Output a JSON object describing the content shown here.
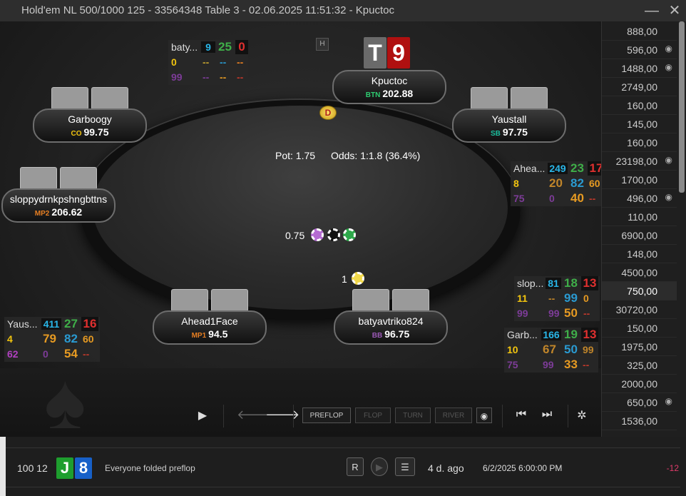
{
  "window": {
    "title": "Hold'em NL 500/1000 125 - 33564348 Table 3 - 02.06.2025 11:51:32 - Kpuctoc",
    "minimize_glyph": "—",
    "close_glyph": "✕"
  },
  "table": {
    "pot_label": "Pot:",
    "pot_value": "1.75",
    "odds_label": "Odds:",
    "odds_value": "1:1.8 (36.4%)",
    "dealer_glyph": "D",
    "bets": [
      {
        "amount": "0.75"
      },
      {
        "amount": "1"
      }
    ],
    "hero_cards": [
      {
        "rank": "T",
        "color": "#6a6a6a"
      },
      {
        "rank": "9",
        "color": "#b01010"
      }
    ],
    "replayer_icon": "hand-history-icon"
  },
  "players": [
    {
      "name": "Kpuctoc",
      "pos": "BTN",
      "stack": "202.88",
      "pos_color": "#2ecc71"
    },
    {
      "name": "Garboogy",
      "pos": "CO",
      "stack": "99.75",
      "pos_color": "#f1c40f"
    },
    {
      "name": "Yaustall",
      "pos": "SB",
      "stack": "97.75",
      "pos_color": "#1abc9c"
    },
    {
      "name": "sloppydrnkpshngbttns",
      "pos": "MP2",
      "stack": "206.62",
      "pos_color": "#e67e22"
    },
    {
      "name": "Ahead1Face",
      "pos": "MP1",
      "stack": "94.5",
      "pos_color": "#e67e22"
    },
    {
      "name": "batyavtriko824",
      "pos": "BB",
      "stack": "96.75",
      "pos_color": "#9b59b6"
    }
  ],
  "huds": [
    {
      "name": "baty...",
      "r1": [
        "9",
        "25",
        "0"
      ],
      "r2": [
        "0",
        "--",
        "--",
        "--"
      ],
      "r3": [
        "99",
        "--",
        "--",
        "--"
      ]
    },
    {
      "name": "Ahea...",
      "r1": [
        "249",
        "23",
        "17"
      ],
      "r2": [
        "8",
        "20",
        "82",
        "60"
      ],
      "r3": [
        "75",
        "0",
        "40",
        "--"
      ]
    },
    {
      "name": "slop...",
      "r1": [
        "81",
        "18",
        "13"
      ],
      "r2": [
        "11",
        "--",
        "99",
        "0"
      ],
      "r3": [
        "99",
        "99",
        "50",
        "--"
      ]
    },
    {
      "name": "Garb...",
      "r1": [
        "166",
        "19",
        "13"
      ],
      "r2": [
        "10",
        "67",
        "50",
        "99"
      ],
      "r3": [
        "75",
        "99",
        "33",
        "--"
      ]
    },
    {
      "name": "Yaus...",
      "r1": [
        "411",
        "27",
        "16"
      ],
      "r2": [
        "4",
        "79",
        "82",
        "60"
      ],
      "r3": [
        "62",
        "0",
        "54",
        "--"
      ]
    }
  ],
  "controls": {
    "play": "▶",
    "prev": "🡐",
    "next": "🡒",
    "streets": [
      "PREFLOP",
      "FLOP",
      "TURN",
      "RIVER"
    ],
    "eye": "◉",
    "first": "⏮",
    "last": "⏭",
    "settings": "✲"
  },
  "sidebar": {
    "items": [
      {
        "value": "888,00",
        "eye": ""
      },
      {
        "value": "596,00",
        "eye": "◉"
      },
      {
        "value": "1488,00",
        "eye": "◉"
      },
      {
        "value": "2749,00",
        "eye": ""
      },
      {
        "value": "160,00",
        "eye": ""
      },
      {
        "value": "145,00",
        "eye": ""
      },
      {
        "value": "160,00",
        "eye": ""
      },
      {
        "value": "23198,00",
        "eye": "◉"
      },
      {
        "value": "1700,00",
        "eye": ""
      },
      {
        "value": "496,00",
        "eye": "◉"
      },
      {
        "value": "110,00",
        "eye": ""
      },
      {
        "value": "6900,00",
        "eye": ""
      },
      {
        "value": "148,00",
        "eye": ""
      },
      {
        "value": "4500,00",
        "eye": ""
      },
      {
        "value": "750,00",
        "eye": "",
        "selected": true
      },
      {
        "value": "30720,00",
        "eye": ""
      },
      {
        "value": "150,00",
        "eye": ""
      },
      {
        "value": "1975,00",
        "eye": ""
      },
      {
        "value": "325,00",
        "eye": ""
      },
      {
        "value": "2000,00",
        "eye": ""
      },
      {
        "value": "650,00",
        "eye": "◉"
      },
      {
        "value": "1536,00",
        "eye": ""
      }
    ]
  },
  "bottom": {
    "stakes": "100 12",
    "cards": [
      {
        "rank": "J",
        "color": "#1e9e2e"
      },
      {
        "rank": "8",
        "color": "#1760c8"
      }
    ],
    "summary": "Everyone folded preflop",
    "replay_btn": "R",
    "play_btn": "▶",
    "notes_btn": "☰",
    "ago": "4 d. ago",
    "datetime": "6/2/2025 6:00:00 PM",
    "result": "-12"
  }
}
